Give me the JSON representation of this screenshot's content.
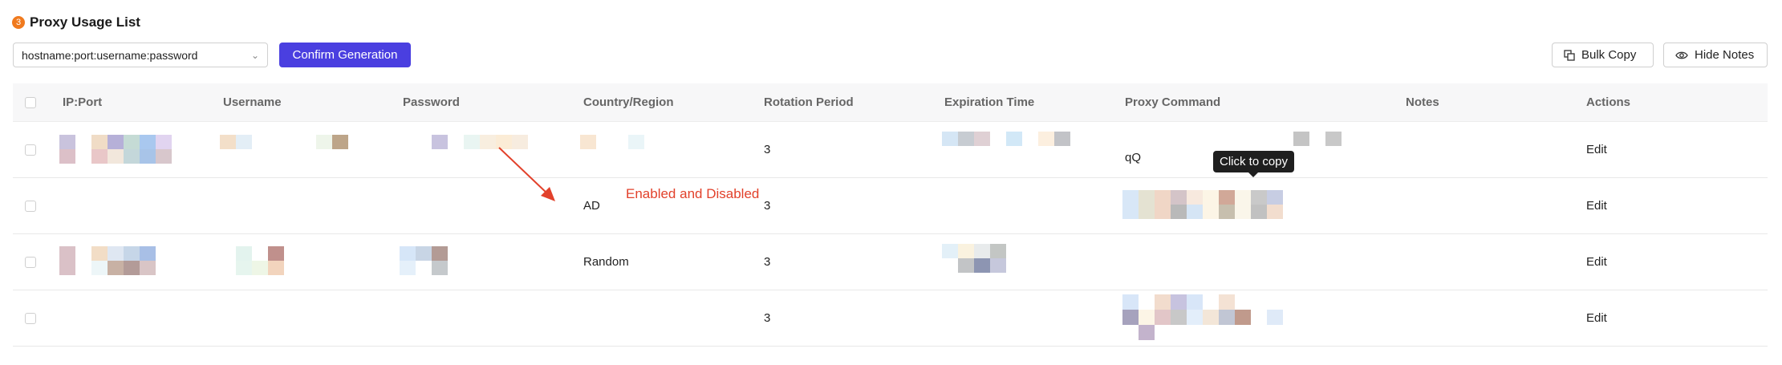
{
  "header": {
    "step": "3",
    "title": "Proxy Usage List"
  },
  "toolbar": {
    "format_select_value": "hostname:port:username:password",
    "confirm_label": "Confirm Generation",
    "bulk_copy_label": "Bulk Copy",
    "hide_notes_label": "Hide Notes"
  },
  "table": {
    "columns": [
      "IP:Port",
      "Username",
      "Password",
      "Country/Region",
      "Rotation Period",
      "Expiration Time",
      "Proxy Command",
      "Notes",
      "Actions"
    ],
    "rows": [
      {
        "country": "",
        "rotation": "3",
        "command": "qQ",
        "action": "Edit"
      },
      {
        "country": "AD",
        "rotation": "3",
        "command": "",
        "action": "Edit"
      },
      {
        "country": "Random",
        "rotation": "3",
        "command": "",
        "action": "Edit"
      },
      {
        "country": "",
        "rotation": "3",
        "command": "",
        "action": "Edit"
      }
    ]
  },
  "tooltip": "Click to copy",
  "annotation": "Enabled and Disabled",
  "colors": {
    "primary": "#4a3fe0",
    "badge": "#f07a1e",
    "annotation": "#e2412b"
  },
  "icons": {
    "select": "chevron-down-icon",
    "bulk_copy": "copy-icon",
    "hide_notes": "eye-icon"
  }
}
